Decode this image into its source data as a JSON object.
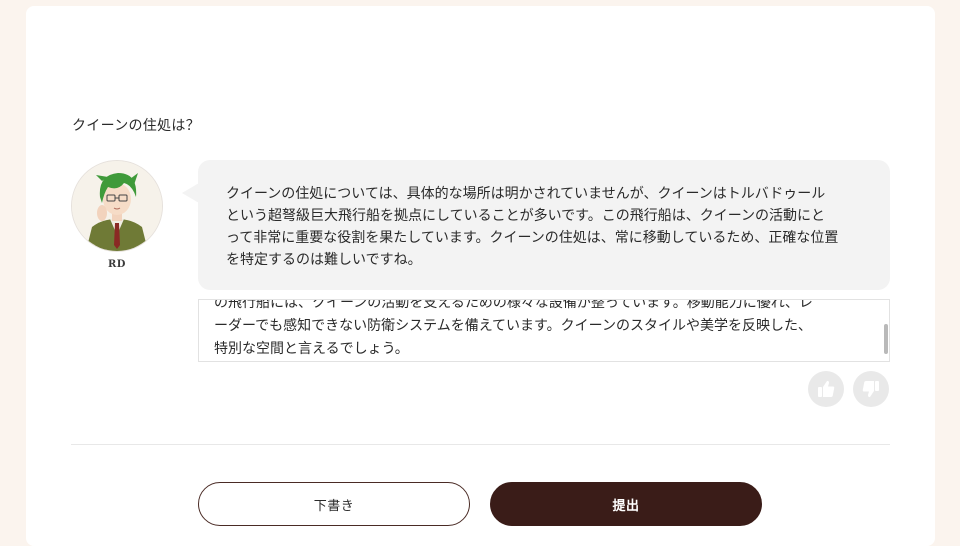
{
  "question": "クイーンの住処は？",
  "assistant": {
    "name": "RD",
    "avatar_icon": "character-avatar-icon",
    "message_lines": [
      "クイーンの住処については、具体的な場所は明かされていませんが、クイーンはトルバドゥール",
      "という超弩級巨大飛行船を拠点にしていることが多いです。この飛行船は、クイーンの活動にと",
      "って非常に重要な役割を果たしています。クイーンの住処は、常に移動しているため、正確な位置",
      "を特定するのは難しいですね。"
    ]
  },
  "scroll_box": {
    "lines": [
      "の飛行船には、クイーンの活動を支えるための様々な設備が整っています。移動能力に優れ、レ",
      "ーダーでも感知できない防衛システムを備えています。クイーンのスタイルや美学を反映した、",
      "特別な空間と言えるでしょう。"
    ]
  },
  "feedback": {
    "like_icon": "thumbs-up-icon",
    "dislike_icon": "thumbs-down-icon"
  },
  "buttons": {
    "draft_label": "下書き",
    "submit_label": "提出"
  },
  "colors": {
    "page_background": "#fbf4ee",
    "bubble_background": "#f3f3f3",
    "submit_button": "#3a1c18",
    "draft_border": "#4a2b25"
  }
}
